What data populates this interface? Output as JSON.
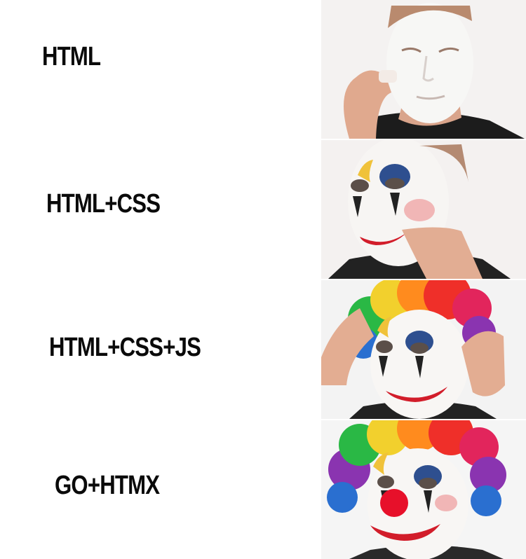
{
  "panels": [
    {
      "caption": "HTML"
    },
    {
      "caption": "HTML+CSS"
    },
    {
      "caption": "HTML+CSS+JS"
    },
    {
      "caption": "GO+HTMX"
    }
  ]
}
